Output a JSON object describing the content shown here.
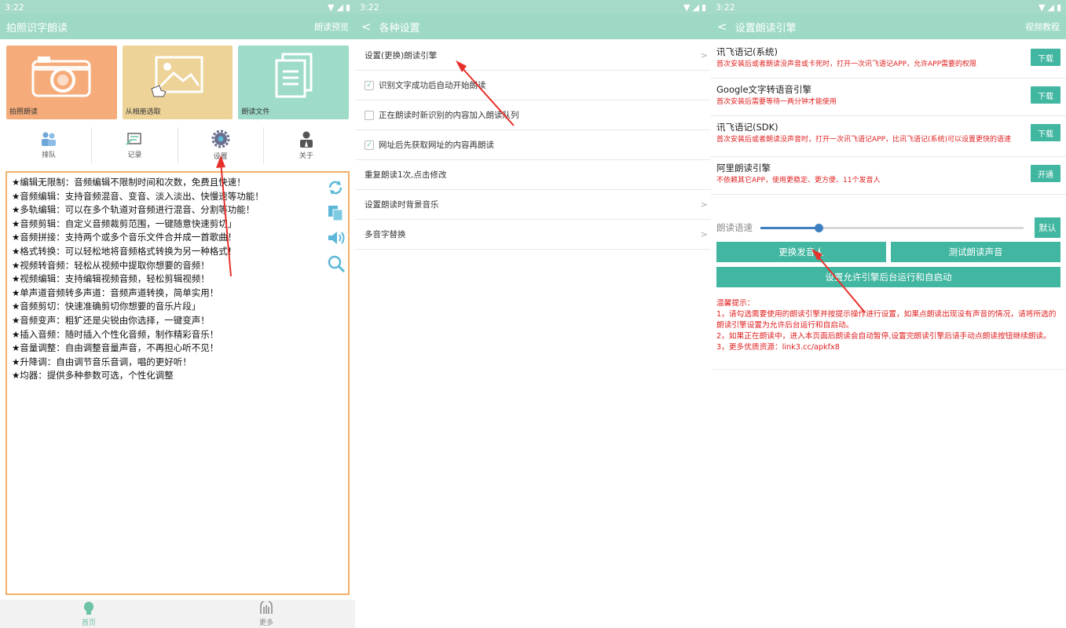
{
  "panel1": {
    "status": {
      "time": "3:22"
    },
    "appbar": {
      "title": "拍照识字朗读",
      "right": "朗读预览"
    },
    "tiles": [
      {
        "label": "拍照朗读"
      },
      {
        "label": "从相册选取"
      },
      {
        "label": "朗读文件"
      }
    ],
    "tools": [
      {
        "label": "排队"
      },
      {
        "label": "记录"
      },
      {
        "label": "设置"
      },
      {
        "label": "关于"
      }
    ],
    "lines": [
      "★编辑无限制：音频编辑不限制时间和次数，免费且快速！",
      "★音频编辑：支持音频混音、变音、淡入淡出、快慢速等功能！",
      "★多轨编辑：可以在多个轨道对音频进行混音、分割等功能！",
      "★音频剪辑：自定义音频裁剪范围，一键随意快速剪切」",
      "★音频拼接：支持两个或多个音乐文件合并成一首歌曲！",
      "★格式转换：可以轻松地将音频格式转换为另一种格式！",
      "★视频转音频：轻松从视频中提取你想要的音频！",
      "★视频编辑：支持编辑视频音频，轻松剪辑视频！",
      "★单声道音频转多声道：音频声道转换，简单实用！",
      "★音频剪切：快速准确剪切你想要的音乐片段」",
      "★音频变声：粗犷还是尖锐由你选择，一键变声！",
      "★插入音频：随时插入个性化音频，制作精彩音乐！",
      "★音量调整：自由调整音量声音，不再担心听不见！",
      "★升降调：自由调节音乐音调，唱的更好听！",
      "★均器：提供多种参数可选，个性化调整"
    ],
    "nav": [
      {
        "label": "首页"
      },
      {
        "label": "更多"
      }
    ]
  },
  "panel2": {
    "status": {
      "time": "3:22"
    },
    "appbar": {
      "title": "各种设置"
    },
    "rows": [
      {
        "label": "设置(更换)朗读引擎",
        "type": "arrow"
      },
      {
        "label": "识别文字成功后自动开始朗读",
        "type": "checkbox",
        "checked": true
      },
      {
        "label": "正在朗读时新识别的内容加入朗读队列",
        "type": "checkbox",
        "checked": false
      },
      {
        "label": "网址后先获取网址的内容再朗读",
        "type": "checkbox",
        "checked": true
      },
      {
        "label": "重复朗读1次,点击修改",
        "type": "plain"
      },
      {
        "label": "设置朗读时背景音乐",
        "type": "arrow"
      },
      {
        "label": "多音字替换",
        "type": "arrow"
      }
    ]
  },
  "panel3": {
    "status": {
      "time": "3:22"
    },
    "appbar": {
      "title": "设置朗读引擎",
      "right": "视频教程"
    },
    "engines": [
      {
        "name": "讯飞语记(系统)",
        "desc": "首次安装后或者朗读没声音或卡死时，打开一次讯飞语记APP，允许APP需要的权限",
        "button": "下载"
      },
      {
        "name": "Google文字转语音引擎",
        "desc": "首次安装后需要等待一两分钟才能使用",
        "button": "下载"
      },
      {
        "name": "讯飞语记(SDK)",
        "desc": "首次安装后或者朗读没声音时，打开一次讯飞语记APP，比讯飞语记(系统)可以设置更快的语速",
        "button": "下载"
      },
      {
        "name": "阿里朗读引擎",
        "desc": "不依赖其它APP，使用更稳定、更方便、11个发音人",
        "button": "开通"
      }
    ],
    "speed": {
      "label": "朗读语速",
      "default_button": "默认",
      "value_fraction": 0.22
    },
    "buttons": {
      "change_voice": "更换发音人",
      "test_voice": "测试朗读声音",
      "allow_background": "设置允许引擎后台运行和自启动"
    },
    "tips": [
      "温馨提示：",
      "1，请勾选需要使用的朗读引擎并按提示操作进行设置，如果点朗读出现没有声音的情况，请将所选的朗读引擎设置为允许后台运行和自启动。",
      "2，如果正在朗读中，进入本页面后朗读会自动暂停,设置完朗读引擎后请手动点朗读按钮继续朗读。",
      "3，更多优质资源：link3.cc/apkfx8"
    ]
  },
  "colors": {
    "accent": "#41b6a1",
    "appbar": "#9ed9c6",
    "warning": "#e02020",
    "textbox_border": "#f3b168"
  }
}
